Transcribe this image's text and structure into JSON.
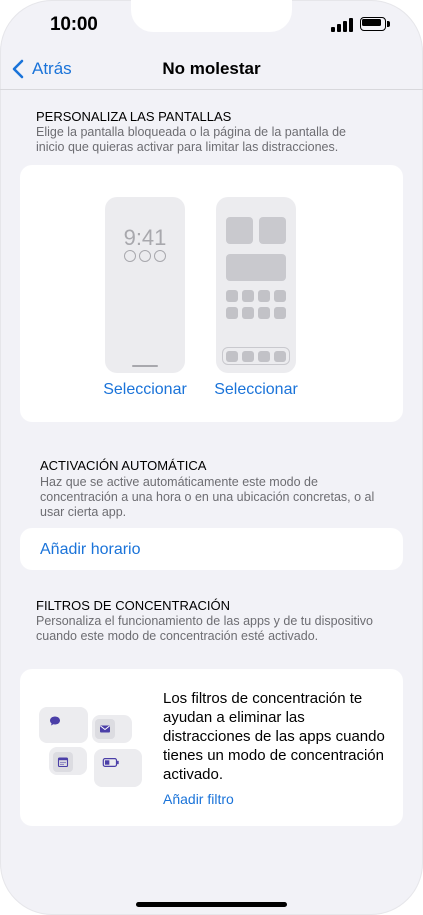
{
  "status_bar": {
    "time": "10:00"
  },
  "nav": {
    "back_label": "Atrás",
    "title": "No molestar"
  },
  "screens_section": {
    "header": "PERSONALIZA LAS PANTALLAS",
    "description": "Elige la pantalla bloqueada o la página de la pantalla de inicio que quieras activar para limitar las distracciones.",
    "lock_preview_time": "9:41",
    "select_lock_label": "Seleccionar",
    "select_home_label": "Seleccionar"
  },
  "auto_section": {
    "header": "ACTIVACIÓN AUTOMÁTICA",
    "description": "Haz que se active automáticamente este modo de concentración a una hora o en una ubicación concretas, o al usar cierta app.",
    "add_schedule_label": "Añadir horario"
  },
  "filters_section": {
    "header": "FILTROS DE CONCENTRACIÓN",
    "description": "Personaliza el funcionamiento de las apps y de tu dispositivo cuando este modo de concentración esté activado.",
    "info_text": "Los filtros de concentración te ayudan a eliminar las distracciones de las apps cuando tienes un modo de concentración activado.",
    "add_filter_label": "Añadir filtro"
  },
  "icons": [
    "back-chevron-icon",
    "signal-icon",
    "battery-icon",
    "message-bubble-icon",
    "mail-icon",
    "calendar-icon",
    "battery-mini-icon"
  ],
  "colors": {
    "accent": "#1a73d9",
    "background": "#f2f2f7",
    "card": "#ffffff",
    "secondary_text": "#6d6d72",
    "filter_icon": "#4b3fa8"
  }
}
